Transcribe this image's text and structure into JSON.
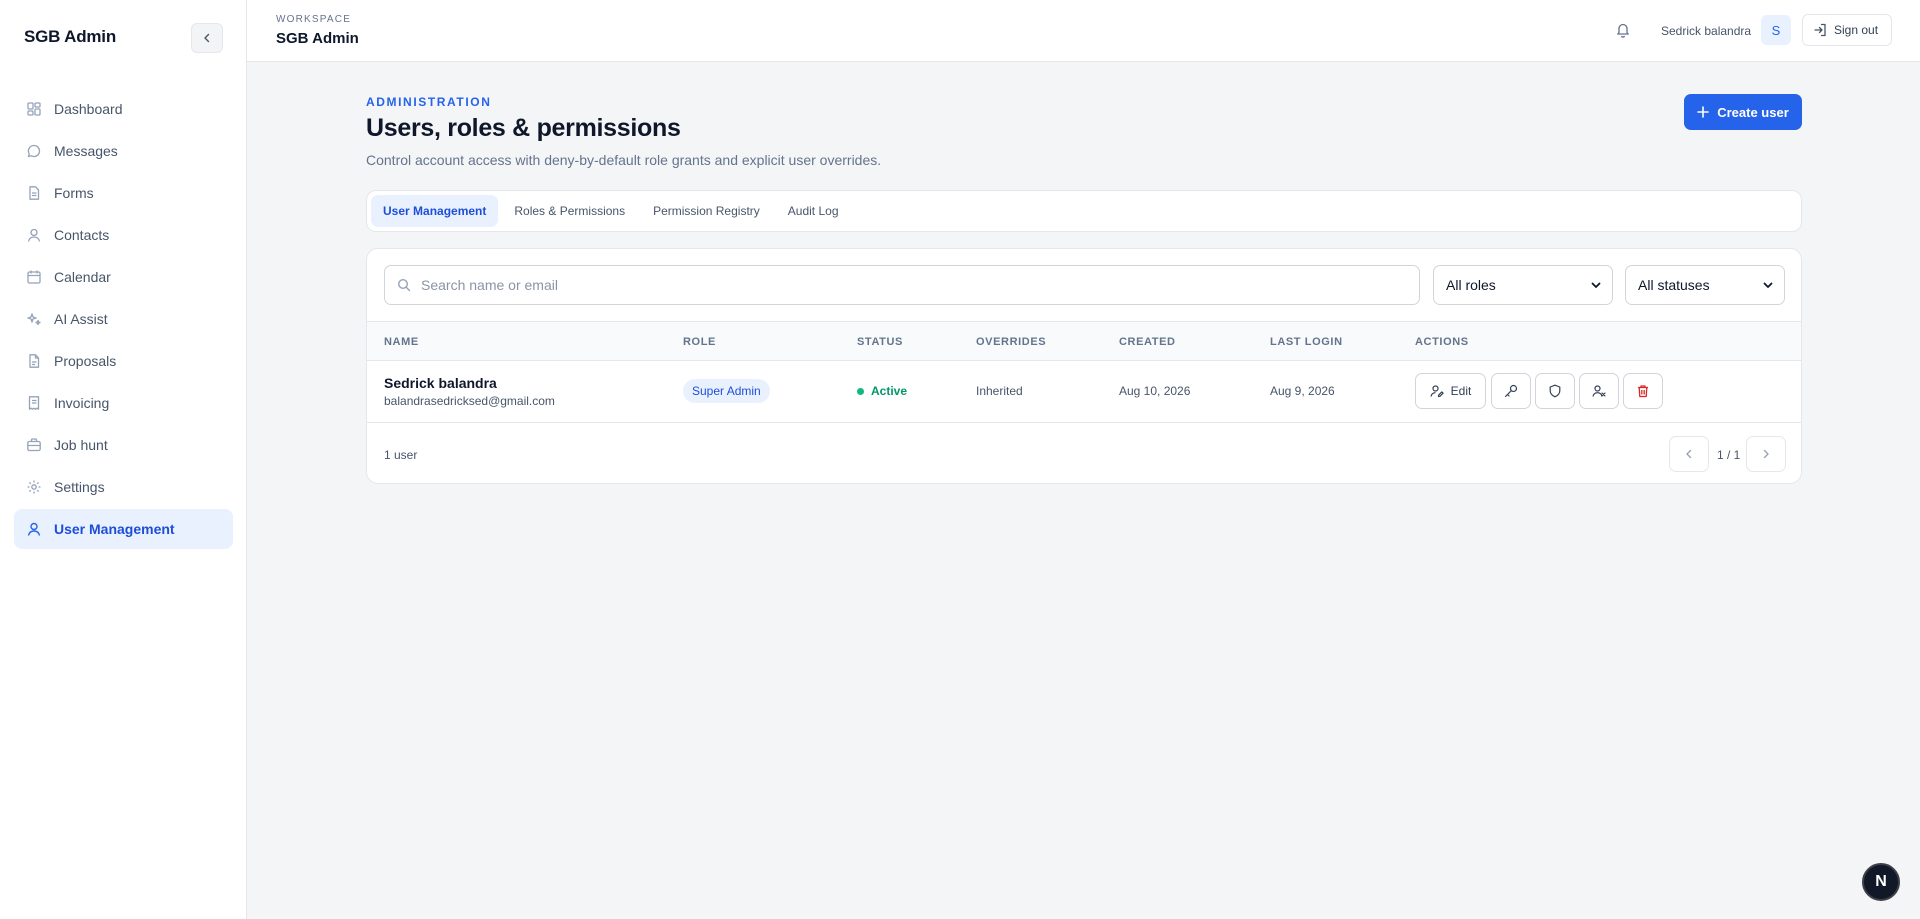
{
  "sidebar": {
    "brand": "SGB Admin",
    "items": [
      {
        "label": "Dashboard",
        "icon": "grid-icon"
      },
      {
        "label": "Messages",
        "icon": "chat-bubble-icon"
      },
      {
        "label": "Forms",
        "icon": "document-icon"
      },
      {
        "label": "Contacts",
        "icon": "user-icon"
      },
      {
        "label": "Calendar",
        "icon": "calendar-icon"
      },
      {
        "label": "AI Assist",
        "icon": "sparkles-icon"
      },
      {
        "label": "Proposals",
        "icon": "file-icon"
      },
      {
        "label": "Invoicing",
        "icon": "receipt-icon"
      },
      {
        "label": "Job hunt",
        "icon": "briefcase-icon"
      },
      {
        "label": "Settings",
        "icon": "gear-icon"
      },
      {
        "label": "User Management",
        "icon": "user-icon",
        "active": true
      }
    ]
  },
  "topbar": {
    "workspace_label": "WORKSPACE",
    "workspace_name": "SGB Admin",
    "user_name": "Sedrick balandra",
    "avatar_initial": "S",
    "signout_label": "Sign out"
  },
  "header": {
    "eyebrow": "ADMINISTRATION",
    "title": "Users, roles & permissions",
    "subtitle": "Control account access with deny-by-default role grants and explicit user overrides.",
    "create_label": "Create user"
  },
  "tabs": [
    {
      "label": "User Management",
      "active": true
    },
    {
      "label": "Roles & Permissions"
    },
    {
      "label": "Permission Registry"
    },
    {
      "label": "Audit Log"
    }
  ],
  "filters": {
    "search_placeholder": "Search name or email",
    "role_selected": "All roles",
    "status_selected": "All statuses"
  },
  "table": {
    "columns": [
      "NAME",
      "ROLE",
      "STATUS",
      "OVERRIDES",
      "CREATED",
      "LAST LOGIN",
      "ACTIONS"
    ],
    "rows": [
      {
        "name": "Sedrick balandra",
        "email": "balandrasedricksed@gmail.com",
        "role": "Super Admin",
        "status": "Active",
        "overrides": "Inherited",
        "created": "Aug 10, 2026",
        "last_login": "Aug 9, 2026",
        "edit_label": "Edit"
      }
    ],
    "count_label": "1 user",
    "page_label": "1 / 1"
  },
  "floating_badge": "N",
  "colors": {
    "accent": "#2563eb",
    "accent_light": "#eaf1fe",
    "success": "#10b981",
    "danger": "#dc2626"
  }
}
